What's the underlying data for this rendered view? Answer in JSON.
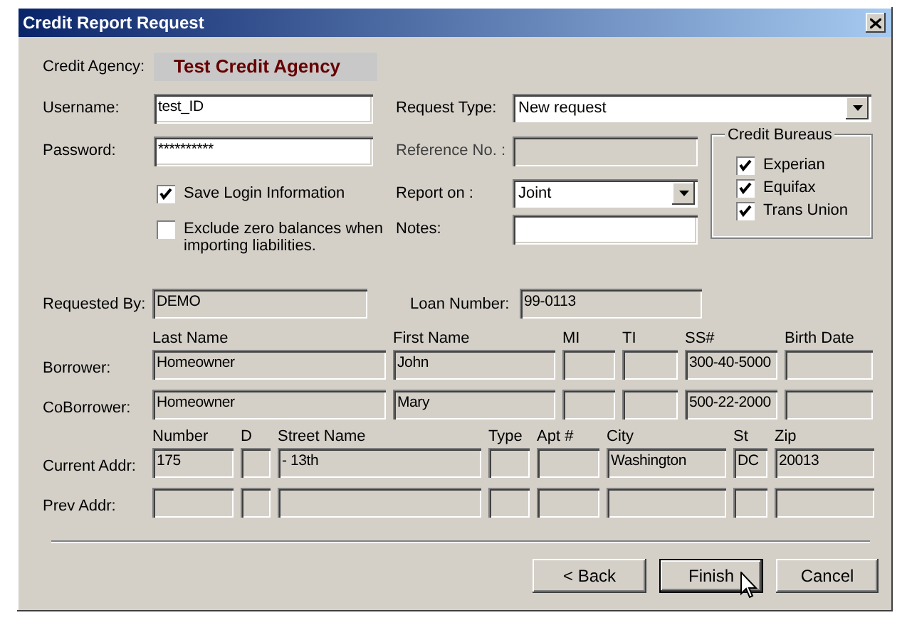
{
  "window": {
    "title": "Credit Report Request"
  },
  "credit_agency": {
    "label": "Credit Agency:",
    "value": "Test Credit Agency"
  },
  "username": {
    "label": "Username:",
    "value": "test_ID",
    "disabled": false
  },
  "password": {
    "label": "Password:",
    "value": "**********",
    "disabled": false
  },
  "options": [
    {
      "label": "Save Login Information",
      "checked": true
    },
    {
      "label": "Exclude zero balances when importing liabilities.",
      "checked": false
    }
  ],
  "request_type": {
    "label": "Request Type:",
    "value": "New request"
  },
  "reference_no": {
    "label": "Reference No. :",
    "disabled": true
  },
  "report_on": {
    "label": "Report on :",
    "value": "Joint"
  },
  "notes": {
    "label": "Notes:",
    "disabled": false
  },
  "credit_bureaus": {
    "title": "Credit Bureaus",
    "items": [
      {
        "label": "Experian",
        "checked": true
      },
      {
        "label": "Equifax",
        "checked": true
      },
      {
        "label": "Trans Union",
        "checked": true
      }
    ]
  },
  "requested_by": {
    "label": "Requested By:",
    "value": "DEMO",
    "disabled": true
  },
  "loan_number": {
    "label": "Loan Number:",
    "value": "99-0113",
    "disabled": true
  },
  "borrowers": {
    "disabled": true,
    "columns": [
      "Last Name",
      "First Name",
      "MI",
      "TI",
      "SS#",
      "Birth Date"
    ],
    "rows": [
      {
        "label": "Borrower:",
        "cells": [
          "Homeowner",
          "John",
          null,
          null,
          "300-40-5000",
          null
        ]
      },
      {
        "label": "CoBorrower:",
        "cells": [
          "Homeowner",
          "Mary",
          null,
          null,
          "500-22-2000",
          null
        ]
      }
    ]
  },
  "addresses": {
    "disabled": true,
    "columns": [
      "Number",
      "D",
      "Street Name",
      "Type",
      "Apt #",
      "City",
      "St",
      "Zip"
    ],
    "rows": [
      {
        "label": "Current Addr:",
        "cells": [
          "175",
          null,
          "- 13th",
          null,
          null,
          "Washington",
          "DC",
          "20013"
        ]
      },
      {
        "label": "Prev Addr:",
        "cells": [
          null,
          null,
          null,
          null,
          null,
          null,
          null,
          null
        ]
      }
    ]
  },
  "buttons": [
    {
      "label": "< Back",
      "default": false
    },
    {
      "label": "Finish",
      "default": true,
      "hovered": true
    },
    {
      "label": "Cancel",
      "default": false
    }
  ]
}
